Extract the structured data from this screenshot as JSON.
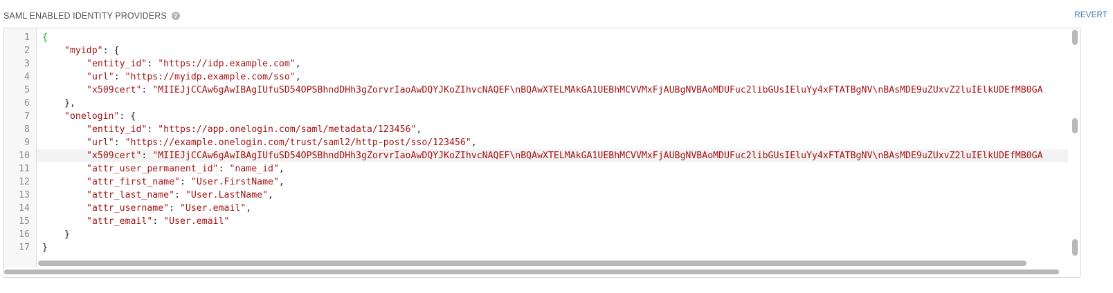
{
  "header": {
    "label": "SAML ENABLED IDENTITY PROVIDERS",
    "help_glyph": "?",
    "revert_label": "REVERT"
  },
  "editor": {
    "language": "json",
    "active_line": 10,
    "lines": [
      {
        "num": "1",
        "indent": 0,
        "tokens": [
          {
            "t": "{",
            "c": "brace-green"
          }
        ]
      },
      {
        "num": "2",
        "indent": 1,
        "tokens": [
          {
            "t": "\"myidp\"",
            "c": "key"
          },
          {
            "t": ": {",
            "c": "punc"
          }
        ]
      },
      {
        "num": "3",
        "indent": 2,
        "tokens": [
          {
            "t": "\"entity_id\"",
            "c": "key"
          },
          {
            "t": ": ",
            "c": "punc"
          },
          {
            "t": "\"https://idp.example.com\"",
            "c": "str"
          },
          {
            "t": ",",
            "c": "punc"
          }
        ]
      },
      {
        "num": "4",
        "indent": 2,
        "tokens": [
          {
            "t": "\"url\"",
            "c": "key"
          },
          {
            "t": ": ",
            "c": "punc"
          },
          {
            "t": "\"https://myidp.example.com/sso\"",
            "c": "str"
          },
          {
            "t": ",",
            "c": "punc"
          }
        ]
      },
      {
        "num": "5",
        "indent": 2,
        "tokens": [
          {
            "t": "\"x509cert\"",
            "c": "key"
          },
          {
            "t": ": ",
            "c": "punc"
          },
          {
            "t": "\"MIIEJjCCAw6gAwIBAgIUfuSD54OPSBhndDHh3gZorvrIaoAwDQYJKoZIhvcNAQEF\\nBQAwXTELMAkGA1UEBhMCVVMxFjAUBgNVBAoMDUFuc2libGUsIEluYy4xFTATBgNV\\nBAsMDE9uZUxvZ2luIElkUDEfMB0GA",
            "c": "str"
          }
        ]
      },
      {
        "num": "6",
        "indent": 1,
        "tokens": [
          {
            "t": "},",
            "c": "punc"
          }
        ]
      },
      {
        "num": "7",
        "indent": 1,
        "tokens": [
          {
            "t": "\"onelogin\"",
            "c": "key"
          },
          {
            "t": ": {",
            "c": "punc"
          }
        ]
      },
      {
        "num": "8",
        "indent": 2,
        "tokens": [
          {
            "t": "\"entity_id\"",
            "c": "key"
          },
          {
            "t": ": ",
            "c": "punc"
          },
          {
            "t": "\"https://app.onelogin.com/saml/metadata/123456\"",
            "c": "str"
          },
          {
            "t": ",",
            "c": "punc"
          }
        ]
      },
      {
        "num": "9",
        "indent": 2,
        "tokens": [
          {
            "t": "\"url\"",
            "c": "key"
          },
          {
            "t": ": ",
            "c": "punc"
          },
          {
            "t": "\"https://example.onelogin.com/trust/saml2/http-post/sso/123456\"",
            "c": "str"
          },
          {
            "t": ",",
            "c": "punc"
          }
        ]
      },
      {
        "num": "10",
        "indent": 2,
        "tokens": [
          {
            "t": "\"x509cert\"",
            "c": "key"
          },
          {
            "t": ": ",
            "c": "punc"
          },
          {
            "t": "\"MIIEJjCCAw6gAwIBAgIUfuSD54OPSBhndDHh3gZorvrIaoAwDQYJKoZIhvcNAQEF\\nBQAwXTELMAkGA1UEBhMCVVMxFjAUBgNVBAoMDUFuc2libGUsIEluYy4xFTATBgNV\\nBAsMDE9uZUxvZ2luIElkUDEfMB0GA",
            "c": "str"
          }
        ]
      },
      {
        "num": "11",
        "indent": 2,
        "tokens": [
          {
            "t": "\"attr_user_permanent_id\"",
            "c": "key"
          },
          {
            "t": ": ",
            "c": "punc"
          },
          {
            "t": "\"name_id\"",
            "c": "str"
          },
          {
            "t": ",",
            "c": "punc"
          }
        ]
      },
      {
        "num": "12",
        "indent": 2,
        "tokens": [
          {
            "t": "\"attr_first_name\"",
            "c": "key"
          },
          {
            "t": ": ",
            "c": "punc"
          },
          {
            "t": "\"User.FirstName\"",
            "c": "str"
          },
          {
            "t": ",",
            "c": "punc"
          }
        ]
      },
      {
        "num": "13",
        "indent": 2,
        "tokens": [
          {
            "t": "\"attr_last_name\"",
            "c": "key"
          },
          {
            "t": ": ",
            "c": "punc"
          },
          {
            "t": "\"User.LastName\"",
            "c": "str"
          },
          {
            "t": ",",
            "c": "punc"
          }
        ]
      },
      {
        "num": "14",
        "indent": 2,
        "tokens": [
          {
            "t": "\"attr_username\"",
            "c": "key"
          },
          {
            "t": ": ",
            "c": "punc"
          },
          {
            "t": "\"User.email\"",
            "c": "str"
          },
          {
            "t": ",",
            "c": "punc"
          }
        ]
      },
      {
        "num": "15",
        "indent": 2,
        "tokens": [
          {
            "t": "\"attr_email\"",
            "c": "key"
          },
          {
            "t": ": ",
            "c": "punc"
          },
          {
            "t": "\"User.email\"",
            "c": "str"
          }
        ]
      },
      {
        "num": "16",
        "indent": 1,
        "tokens": [
          {
            "t": "}",
            "c": "punc"
          }
        ]
      },
      {
        "num": "17",
        "indent": 0,
        "tokens": [
          {
            "t": "}",
            "c": "punc"
          }
        ]
      }
    ]
  },
  "colors": {
    "string": "#a31515",
    "brace_open": "#00bb00",
    "link": "#337ab7",
    "gutter_bg": "#f7f7f7"
  },
  "icons": {
    "help": "question-circle-icon"
  }
}
